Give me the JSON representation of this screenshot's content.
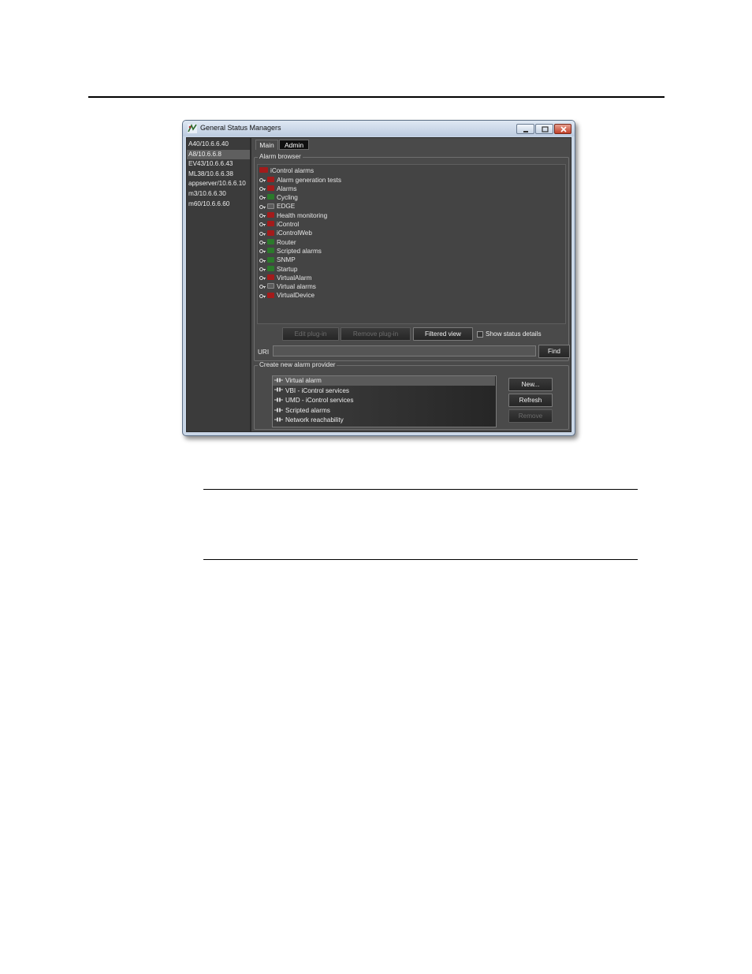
{
  "window": {
    "title": "General Status Managers"
  },
  "servers": [
    {
      "label": "A40/10.6.6.40",
      "selected": false
    },
    {
      "label": "A8/10.6.6.8",
      "selected": true
    },
    {
      "label": "EV43/10.6.6.43",
      "selected": false
    },
    {
      "label": "ML38/10.6.6.38",
      "selected": false
    },
    {
      "label": "appserver/10.6.6.10",
      "selected": false
    },
    {
      "label": "m3/10.6.6.30",
      "selected": false
    },
    {
      "label": "m60/10.6.6.60",
      "selected": false
    }
  ],
  "tabs": {
    "main": "Main",
    "admin": "Admin"
  },
  "alarm_browser": {
    "label": "Alarm browser",
    "root": {
      "label": "iControl alarms",
      "folder_color": "red"
    },
    "nodes": [
      {
        "label": "Alarm generation tests",
        "folder_color": "red"
      },
      {
        "label": "Alarms",
        "folder_color": "red"
      },
      {
        "label": "Cycling",
        "folder_color": "green"
      },
      {
        "label": "EDGE",
        "folder_color": "grey"
      },
      {
        "label": "Health monitoring",
        "folder_color": "red"
      },
      {
        "label": "iControl",
        "folder_color": "red"
      },
      {
        "label": "iControlWeb",
        "folder_color": "red"
      },
      {
        "label": "Router",
        "folder_color": "green"
      },
      {
        "label": "Scripted alarms",
        "folder_color": "green"
      },
      {
        "label": "SNMP",
        "folder_color": "green"
      },
      {
        "label": "Startup",
        "folder_color": "green"
      },
      {
        "label": "VirtualAlarm",
        "folder_color": "red"
      },
      {
        "label": "Virtual alarms",
        "folder_color": "grey"
      },
      {
        "label": "VirtualDevice",
        "folder_color": "red"
      }
    ],
    "buttons": {
      "edit_plugin": "Edit plug-in",
      "remove_plugin": "Remove plug-in",
      "filtered_view": "Filtered view"
    },
    "show_status_details": "Show status details",
    "uri_label": "URI",
    "uri_value": "",
    "find": "Find"
  },
  "provider": {
    "label": "Create new alarm provider",
    "items": [
      {
        "label": "Virtual alarm",
        "selected": true
      },
      {
        "label": "VBI - iControl services",
        "selected": false
      },
      {
        "label": "UMD - iControl services",
        "selected": false
      },
      {
        "label": "Scripted alarms",
        "selected": false
      },
      {
        "label": "Network reachability",
        "selected": false
      }
    ],
    "buttons": {
      "new": "New...",
      "refresh": "Refresh",
      "remove": "Remove"
    }
  },
  "colors": {
    "folder_red": "#a31b1b",
    "folder_green": "#2b7a2b",
    "folder_grey": "#5c5c5c",
    "panel_bg": "#4a4a4a"
  }
}
